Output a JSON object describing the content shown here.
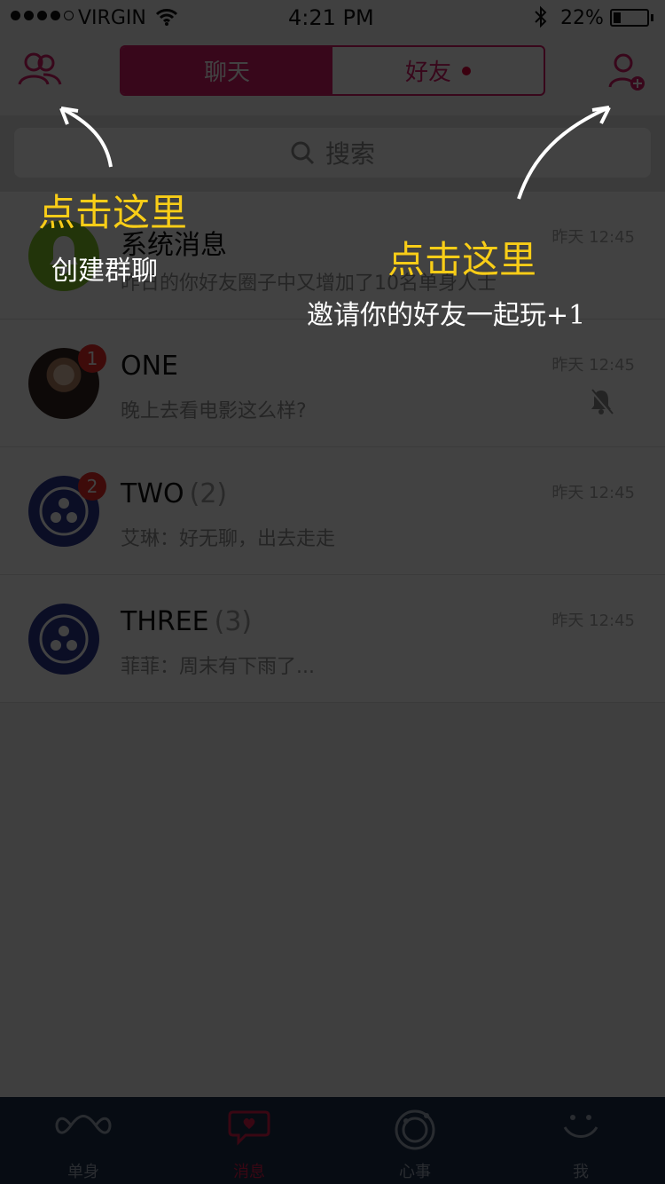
{
  "status_bar": {
    "carrier": "VIRGIN",
    "time": "4:21 PM",
    "battery_percent": "22%",
    "signal_bars": 4,
    "battery_level": 0.22
  },
  "header": {
    "segments": [
      {
        "label": "聊天",
        "active": true
      },
      {
        "label": "好友",
        "active": false,
        "has_dot": true
      }
    ],
    "group_chat_icon": "group-people-icon",
    "add_friend_icon": "add-friend-icon"
  },
  "search": {
    "placeholder": "搜索",
    "icon": "search-icon"
  },
  "chats": [
    {
      "name": "系统消息",
      "count": "",
      "preview": "昨日的你好友圈子中又增加了10名单身人士",
      "time": "昨天 12:45",
      "avatar": "system-avatar",
      "badge": "",
      "muted": false
    },
    {
      "name": "ONE",
      "count": "",
      "preview": "晚上去看电影这么样?",
      "time": "昨天 12:45",
      "avatar": "photo-avatar",
      "badge": "1",
      "muted": true
    },
    {
      "name": "TWO",
      "count": "(2)",
      "preview": "艾琳：好无聊，出去走走",
      "time": "昨天 12:45",
      "avatar": "group-avatar",
      "badge": "2",
      "muted": false
    },
    {
      "name": "THREE",
      "count": "(3)",
      "preview": "菲菲：周末有下雨了...",
      "time": "昨天 12:45",
      "avatar": "group-avatar",
      "badge": "",
      "muted": false
    }
  ],
  "tab_bar": {
    "tabs": [
      {
        "label": "单身",
        "icon": "infinity-icon",
        "active": false
      },
      {
        "label": "消息",
        "icon": "chat-bubble-heart-icon",
        "active": true
      },
      {
        "label": "心事",
        "icon": "camera-circle-icon",
        "active": false
      },
      {
        "label": "我",
        "icon": "smile-icon",
        "active": false
      }
    ]
  },
  "overlay_hints": {
    "left_title": "点击这里",
    "left_desc": "创建群聊",
    "right_title": "点击这里",
    "right_desc": "邀请你的好友一起玩+1"
  },
  "colors": {
    "accent": "#d91d6a",
    "overlay": "#000000",
    "hint_yellow": "#f8cd18",
    "tab_bar": "#1e2f4b"
  }
}
